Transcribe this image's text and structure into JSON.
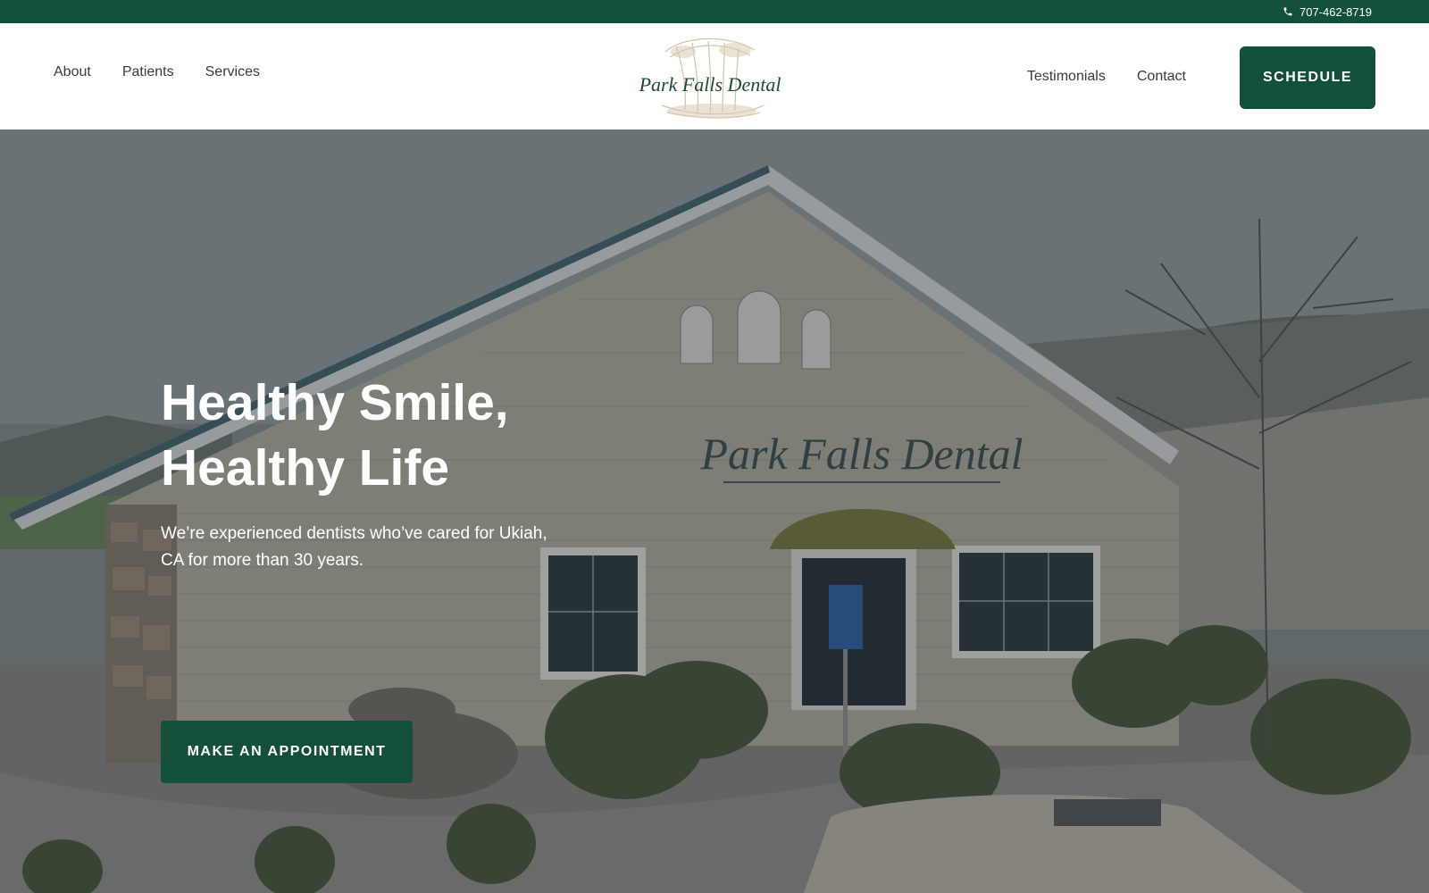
{
  "topbar": {
    "phone": "707-462-8719",
    "phone_icon": "phone-icon"
  },
  "header": {
    "logo_text": "Park Falls Dental",
    "nav_left": [
      "About",
      "Patients",
      "Services"
    ],
    "nav_right": [
      "Testimonials",
      "Contact"
    ],
    "schedule_label": "SCHEDULE"
  },
  "hero": {
    "title_line1": "Healthy Smile,",
    "title_line2": "Healthy Life",
    "subtitle": "We’re experienced dentists who’ve cared for Ukiah, CA for more than 30 years.",
    "cta_label": "MAKE AN APPOINTMENT",
    "sign_text": "Park Falls Dental",
    "background": "photo-of-dental-office-building"
  },
  "colors": {
    "brand_green": "#13503a",
    "topbar_bg": "#13503a",
    "text_dark": "#3a3a3a",
    "white": "#ffffff"
  }
}
